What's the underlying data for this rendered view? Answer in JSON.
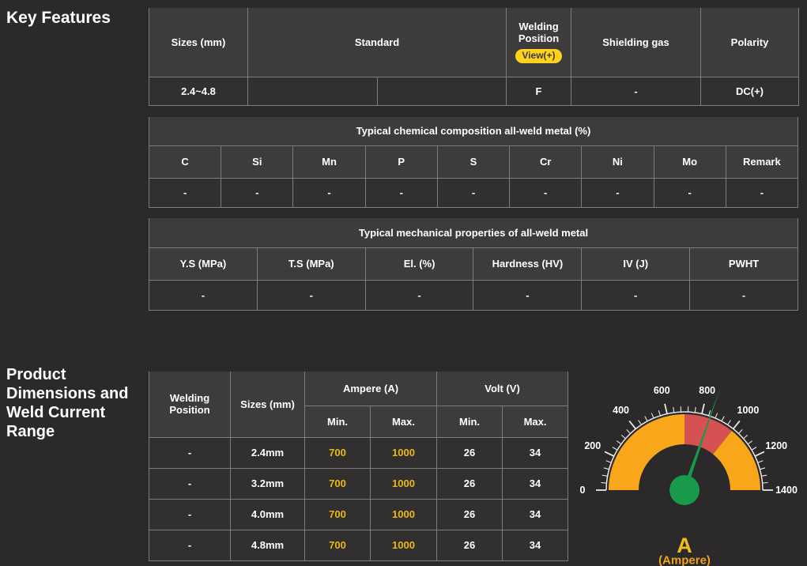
{
  "headings": {
    "key_features": "Key Features",
    "product_dimensions": "Product Dimensions and Weld Current Range"
  },
  "key_features_table": {
    "headers": {
      "sizes": "Sizes (mm)",
      "standard": "Standard",
      "welding_position": "Welding Position",
      "view_button": "View(+)",
      "shielding_gas": "Shielding gas",
      "polarity": "Polarity"
    },
    "row": {
      "sizes": "2.4~4.8",
      "standard_1": "",
      "standard_2": "",
      "welding_position": "F",
      "shielding_gas": "-",
      "polarity": "DC(+)"
    }
  },
  "chemical_table": {
    "title": "Typical chemical composition all-weld metal (%)",
    "columns": [
      "C",
      "Si",
      "Mn",
      "P",
      "S",
      "Cr",
      "Ni",
      "Mo",
      "Remark"
    ],
    "values": [
      "-",
      "-",
      "-",
      "-",
      "-",
      "-",
      "-",
      "-",
      "-"
    ]
  },
  "mechanical_table": {
    "title": "Typical mechanical properties of all-weld metal",
    "columns": [
      "Y.S (MPa)",
      "T.S (MPa)",
      "El. (%)",
      "Hardness (HV)",
      "IV (J)",
      "PWHT"
    ],
    "values": [
      "-",
      "-",
      "-",
      "-",
      "-",
      "-"
    ]
  },
  "current_range_table": {
    "headers": {
      "welding_position": "Welding Position",
      "sizes": "Sizes (mm)",
      "ampere": "Ampere (A)",
      "volt": "Volt (V)",
      "min": "Min.",
      "max": "Max."
    },
    "rows": [
      [
        "-",
        "2.4mm",
        "700",
        "1000",
        "26",
        "34"
      ],
      [
        "-",
        "3.2mm",
        "700",
        "1000",
        "26",
        "34"
      ],
      [
        "-",
        "4.0mm",
        "700",
        "1000",
        "26",
        "34"
      ],
      [
        "-",
        "4.8mm",
        "700",
        "1000",
        "26",
        "34"
      ]
    ]
  },
  "chart_data": {
    "type": "gauge",
    "min": 0,
    "max": 1400,
    "major_tick_interval": 200,
    "minor_tick_interval": 40,
    "tick_labels": [
      0,
      200,
      400,
      600,
      800,
      1000,
      1200,
      1400
    ],
    "zones": [
      {
        "from": 0,
        "to": 700,
        "color": "#F9A61B"
      },
      {
        "from": 700,
        "to": 1000,
        "color": "#D65151"
      },
      {
        "from": 1000,
        "to": 1400,
        "color": "#F9A61B"
      }
    ],
    "needle_value": 850,
    "needle_color": "#189A4A",
    "tick_color": "#E8E8E8",
    "label_color": "#FFFFFF",
    "unit_label": "A",
    "unit_sublabel": "(Ampere)",
    "unit_label_color": "#F0BE19",
    "unit_sublabel_color": "#F2A31C"
  },
  "colors": {
    "page_bg": "#2B292A",
    "header_bg": "#3D3B3C",
    "cell_bg": "#312F30",
    "border": "#7D7B7C",
    "text": "#FFFFFF",
    "ampere_value_yellow": "#EDB90F",
    "view_button_bg": "#FFD21E",
    "view_button_text": "#3A3A3A"
  }
}
